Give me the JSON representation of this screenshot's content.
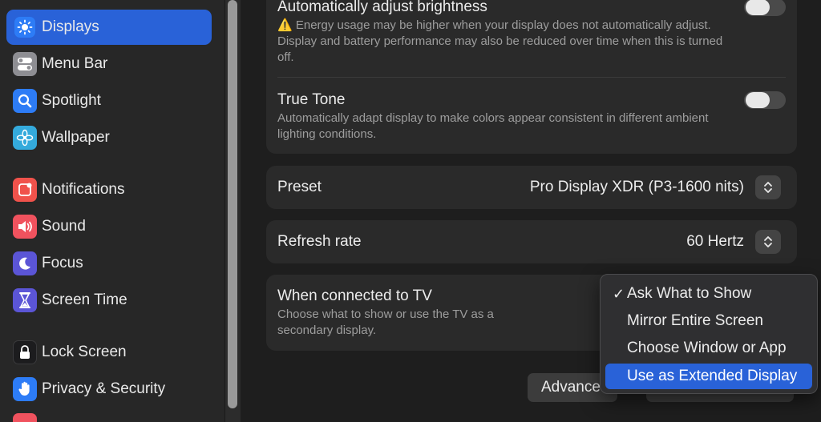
{
  "sidebar": {
    "items": [
      {
        "label": "Displays",
        "icon": "sun-icon",
        "color": "#2d7cf6",
        "active": true
      },
      {
        "label": "Menu Bar",
        "icon": "toggle-icon",
        "color": "#8e8e93",
        "active": false
      },
      {
        "label": "Spotlight",
        "icon": "magnifier-icon",
        "color": "#2d7cf6",
        "active": false
      },
      {
        "label": "Wallpaper",
        "icon": "flower-icon",
        "color": "#34aadc",
        "active": false
      },
      {
        "label": "Notifications",
        "icon": "bell-icon",
        "color": "#f0524b",
        "active": false
      },
      {
        "label": "Sound",
        "icon": "speaker-icon",
        "color": "#f0525e",
        "active": false
      },
      {
        "label": "Focus",
        "icon": "moon-icon",
        "color": "#5b55d6",
        "active": false
      },
      {
        "label": "Screen Time",
        "icon": "hourglass-icon",
        "color": "#5b55d6",
        "active": false
      },
      {
        "label": "Lock Screen",
        "icon": "lock-icon",
        "color": "#1c1c1e",
        "active": false
      },
      {
        "label": "Privacy & Security",
        "icon": "hand-icon",
        "color": "#2d7cf6",
        "active": false
      }
    ]
  },
  "brightness": {
    "title": "Automatically adjust brightness",
    "warning_icon": "⚠️",
    "desc": "Energy usage may be higher when your display does not automatically adjust. Display and battery performance may also be reduced over time when this is turned off."
  },
  "true_tone": {
    "title": "True Tone",
    "desc": "Automatically adapt display to make colors appear consistent in different ambient lighting conditions."
  },
  "preset": {
    "label": "Preset",
    "value": "Pro Display XDR (P3-1600 nits)"
  },
  "refresh": {
    "label": "Refresh rate",
    "value": "60 Hertz"
  },
  "tv": {
    "title": "When connected to TV",
    "desc": "Choose what to show or use the TV as a secondary display."
  },
  "buttons": {
    "advanced": "Advanced..."
  },
  "popup": {
    "check_mark": "✓",
    "items": [
      {
        "label": "Ask What to Show",
        "checked": true,
        "highlighted": false
      },
      {
        "label": "Mirror Entire Screen",
        "checked": false,
        "highlighted": false
      },
      {
        "label": "Choose Window or App",
        "checked": false,
        "highlighted": false
      },
      {
        "label": "Use as Extended Display",
        "checked": false,
        "highlighted": true
      }
    ]
  },
  "colors": {
    "accent": "#2962d8",
    "background": "#1e1e1e",
    "card": "#2a2a2a"
  }
}
